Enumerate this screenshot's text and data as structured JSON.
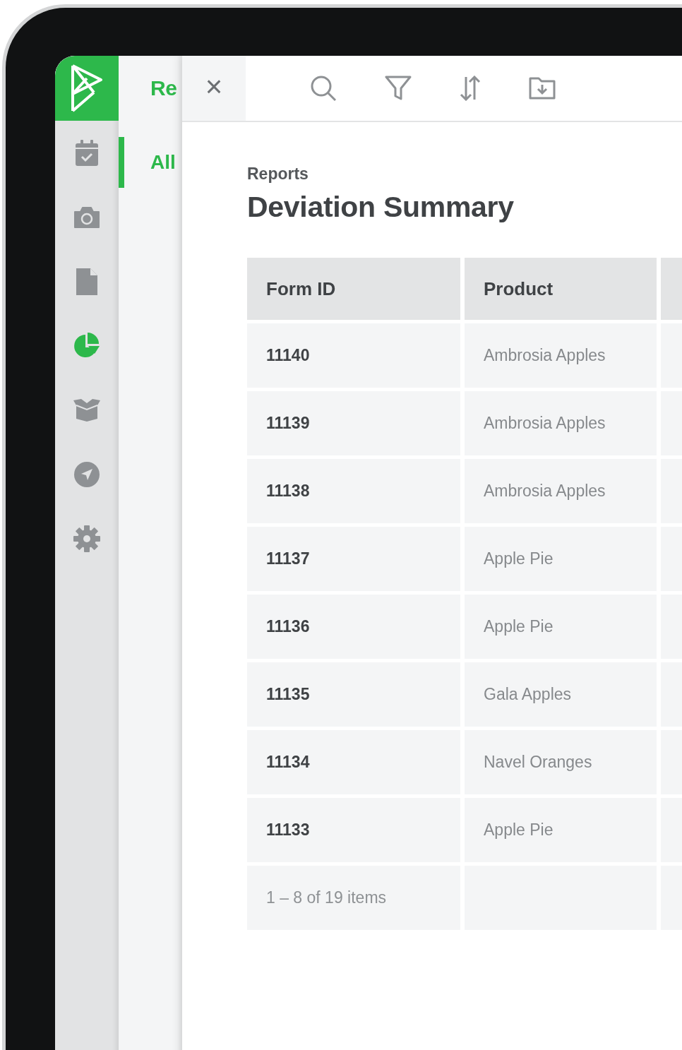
{
  "rail": {
    "items": [
      {
        "kind": "calendar",
        "selected": false
      },
      {
        "kind": "camera",
        "selected": false
      },
      {
        "kind": "document",
        "selected": false
      },
      {
        "kind": "chart",
        "selected": true
      },
      {
        "kind": "box",
        "selected": false
      },
      {
        "kind": "navigate",
        "selected": false
      },
      {
        "kind": "settings",
        "selected": false
      }
    ]
  },
  "subnav": {
    "title": "Re",
    "items": [
      {
        "label": "All",
        "selected": true
      }
    ]
  },
  "toolbar": {
    "close": "×",
    "tools": [
      {
        "kind": "search"
      },
      {
        "kind": "filter"
      },
      {
        "kind": "sort"
      },
      {
        "kind": "export"
      }
    ]
  },
  "breadcrumb": "Reports",
  "title": "Deviation Summary",
  "table": {
    "columns": [
      "Form ID",
      "Product"
    ],
    "rows": [
      {
        "form_id": "11140",
        "product": "Ambrosia Apples"
      },
      {
        "form_id": "11139",
        "product": "Ambrosia Apples"
      },
      {
        "form_id": "11138",
        "product": "Ambrosia Apples"
      },
      {
        "form_id": "11137",
        "product": "Apple Pie"
      },
      {
        "form_id": "11136",
        "product": "Apple Pie"
      },
      {
        "form_id": "11135",
        "product": "Gala Apples"
      },
      {
        "form_id": "11134",
        "product": "Navel Oranges"
      },
      {
        "form_id": "11133",
        "product": "Apple Pie"
      }
    ],
    "footer": "1 – 8 of 19 items"
  }
}
